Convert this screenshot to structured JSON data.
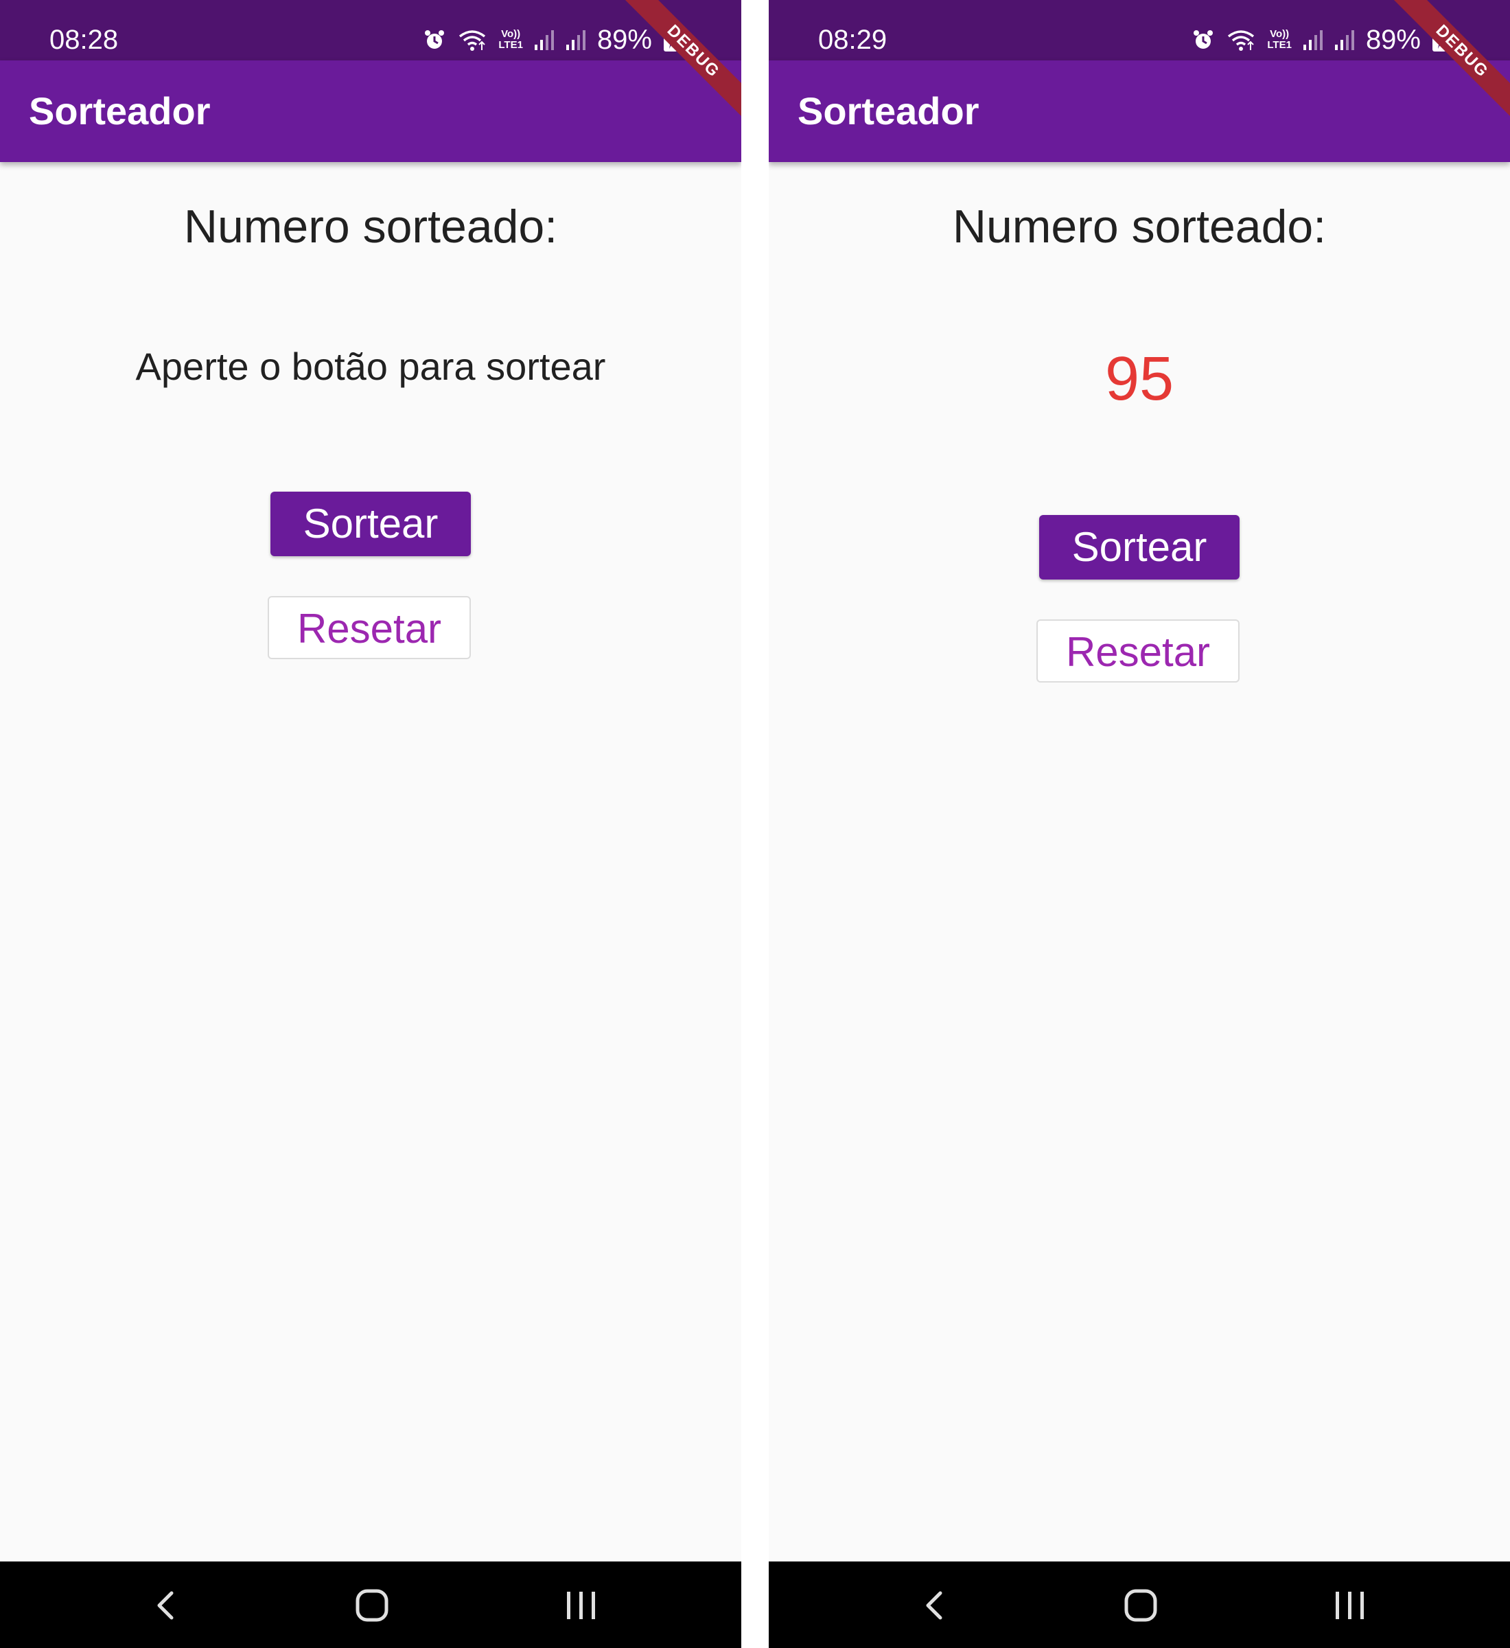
{
  "screens": [
    {
      "status_bar": {
        "time": "08:28",
        "battery": "89%",
        "volte_label_top": "Vo))",
        "volte_label_bottom": "LTE1"
      },
      "debug_banner": "DEBUG",
      "app_bar": {
        "title": "Sorteador"
      },
      "content": {
        "heading": "Numero sorteado:",
        "result_text": "Aperte o botão para sortear"
      },
      "buttons": {
        "sortear_label": "Sortear",
        "resetar_label": "Resetar"
      }
    },
    {
      "status_bar": {
        "time": "08:29",
        "battery": "89%",
        "volte_label_top": "Vo))",
        "volte_label_bottom": "LTE1"
      },
      "debug_banner": "DEBUG",
      "app_bar": {
        "title": "Sorteador"
      },
      "content": {
        "heading": "Numero sorteado:",
        "result_number": "95"
      },
      "buttons": {
        "sortear_label": "Sortear",
        "resetar_label": "Resetar"
      }
    }
  ],
  "colors": {
    "status_bar": "#4f136e",
    "app_bar": "#6a1b9a",
    "primary_button": "#6a1b9a",
    "outline_button_text": "#9c27b0",
    "result_number": "#e53935",
    "background": "#fafafa",
    "debug_banner": "#9a2336"
  },
  "icons": {
    "status": [
      "alarm-icon",
      "wifi-icon",
      "volte-icon",
      "signal-icon",
      "signal-icon",
      "battery-charging-icon"
    ],
    "navigation": [
      "back-icon",
      "home-icon",
      "recents-icon"
    ]
  }
}
